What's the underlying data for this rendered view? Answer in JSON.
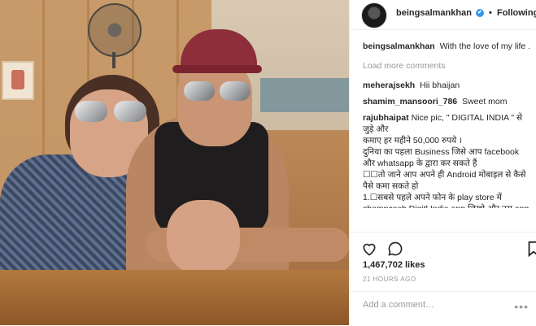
{
  "header": {
    "username": "beingsalmankhan",
    "verified_symbol": "✔",
    "separator": "•",
    "follow_status": "Following"
  },
  "caption": {
    "username": "beingsalmankhan",
    "text": "With the love of my life ."
  },
  "load_more": "Load more comments",
  "comments": [
    {
      "username": "meherajsekh",
      "text": "Hii bhaijan"
    },
    {
      "username": "shamim_mansoori_786",
      "text": "Sweet mom"
    },
    {
      "username": "rajubhaipat",
      "text": "Nice pic, \" DIGITAL INDIA \" से जुड़े और\nकमाए हर महीने 50,000 रुपये ।\nदुनिया का पहला Business जिसे आप facebook और whatsapp के द्वारा कर सकते हैं\n☐☐तो जाने आप अपने ही Android मोबाइल से कैसे\nपैसे कमा सकते हो\n1.☐सबसे पहले अपने फोन के play store में\nchampcash Digitl India app लिखो और उस app को install कर लो !"
    }
  ],
  "actions": {
    "like_icon": "heart-icon",
    "comment_icon": "comment-bubble-icon",
    "bookmark_icon": "bookmark-icon"
  },
  "likes": "1,467,702 likes",
  "time_ago": "21 HOURS AGO",
  "add_comment_placeholder": "Add a comment…",
  "options_icon": "ellipsis-icon",
  "colors": {
    "verified": "#3897f0",
    "muted": "#999999",
    "text": "#262626"
  }
}
